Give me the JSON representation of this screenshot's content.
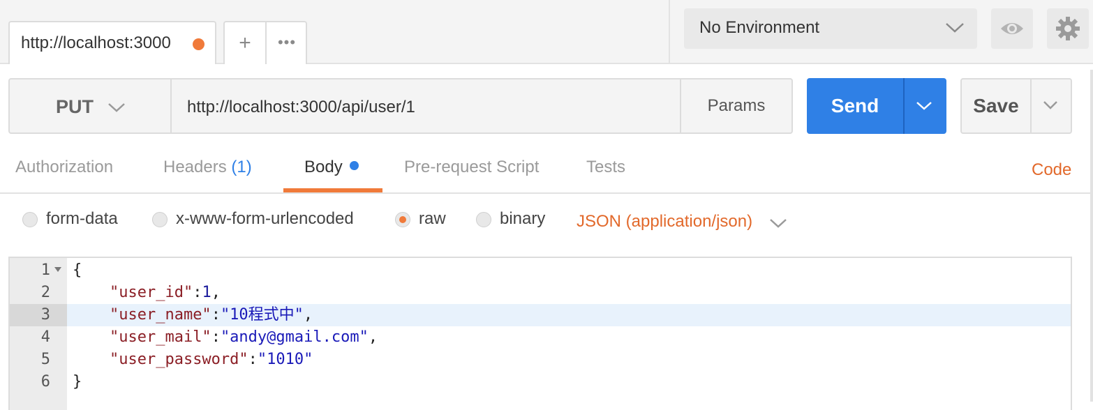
{
  "tabs": {
    "active_tab_label": "http://localhost:3000",
    "add_tab_label": "+",
    "more_label": "•••"
  },
  "environment": {
    "selected": "No Environment",
    "icons": [
      "eye-icon",
      "gear-icon"
    ]
  },
  "request": {
    "method": "PUT",
    "url": "http://localhost:3000/api/user/1",
    "params_label": "Params",
    "send_label": "Send",
    "save_label": "Save"
  },
  "request_tabs": {
    "authorization": "Authorization",
    "headers": "Headers",
    "headers_count": "(1)",
    "body": "Body",
    "pre_request": "Pre-request Script",
    "tests": "Tests",
    "code_link": "Code"
  },
  "body_options": {
    "form_data": "form-data",
    "urlencoded": "x-www-form-urlencoded",
    "raw": "raw",
    "binary": "binary",
    "selected": "raw",
    "content_type": "JSON (application/json)"
  },
  "editor": {
    "line_numbers": [
      "1",
      "2",
      "3",
      "4",
      "5",
      "6"
    ],
    "current_line": 3,
    "open_brace": "{",
    "close_brace": "}",
    "key_user_id": "\"user_id\"",
    "val_user_id": "1",
    "key_user_name": "\"user_name\"",
    "val_user_name": "\"10程式中\"",
    "key_user_mail": "\"user_mail\"",
    "val_user_mail": "\"andy@gmail.com\"",
    "key_user_password": "\"user_password\"",
    "val_user_password": "\"1010\"",
    "colon": ":",
    "comma": ","
  },
  "colors": {
    "accent_orange": "#f07a3a",
    "send_blue": "#2f80e6",
    "json_key": "#8b1f26",
    "json_string": "#1a1ab8"
  }
}
